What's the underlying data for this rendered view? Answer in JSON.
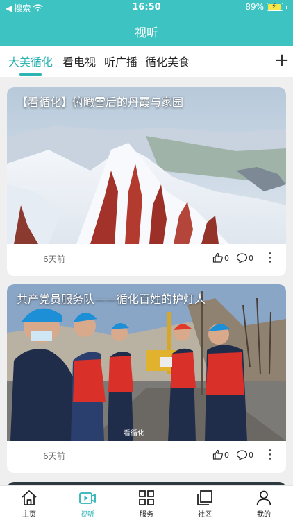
{
  "status_bar": {
    "carrier": "搜索",
    "time": "16:50",
    "battery_percent": "89%",
    "battery_level": 0.89
  },
  "header": {
    "title": "视听"
  },
  "tabs": [
    {
      "label": "大美循化",
      "active": true
    },
    {
      "label": "看电视",
      "active": false
    },
    {
      "label": "听广播",
      "active": false
    },
    {
      "label": "循化美食",
      "active": false
    }
  ],
  "feed": [
    {
      "title": "【看循化】俯瞰雪后的丹霞与家园",
      "date": "6天前",
      "likes": "0",
      "comments": "0"
    },
    {
      "title": "共产党员服务队——循化百姓的护灯人",
      "date": "6天前",
      "likes": "0",
      "comments": "0",
      "watermark": "看循化"
    }
  ],
  "bottom_nav": [
    {
      "label": "主页",
      "icon": "home-icon",
      "active": false
    },
    {
      "label": "视听",
      "icon": "video-icon",
      "active": true
    },
    {
      "label": "服务",
      "icon": "grid-icon",
      "active": false
    },
    {
      "label": "社区",
      "icon": "community-icon",
      "active": false
    },
    {
      "label": "我的",
      "icon": "profile-icon",
      "active": false
    }
  ],
  "colors": {
    "accent": "#3cc3c2",
    "active_text": "#2cb3b2"
  }
}
